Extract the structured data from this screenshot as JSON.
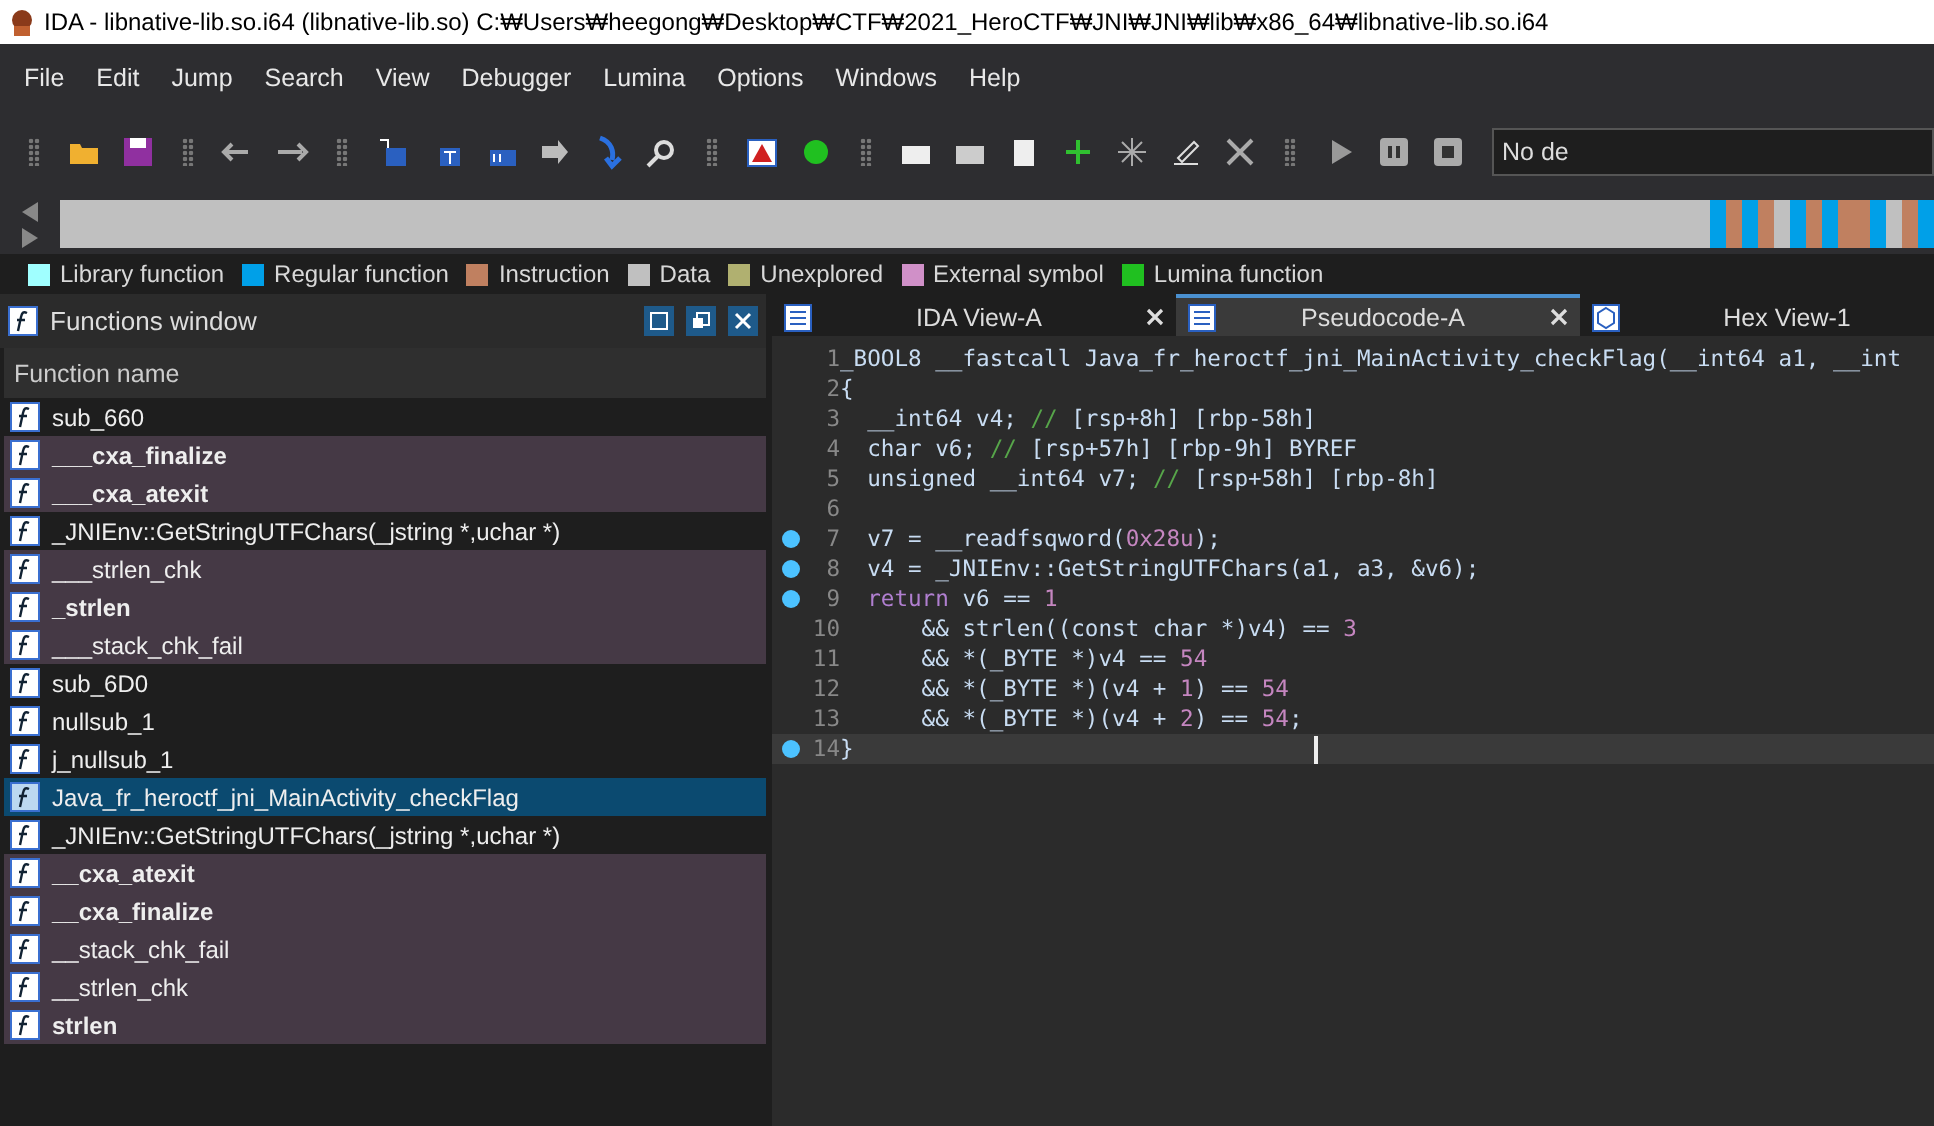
{
  "window": {
    "title": "IDA - libnative-lib.so.i64 (libnative-lib.so) C:₩Users₩heegong₩Desktop₩CTF₩2021_HeroCTF₩JNI₩JNI₩lib₩x86_64₩libnative-lib.so.i64"
  },
  "menu": [
    "File",
    "Edit",
    "Jump",
    "Search",
    "View",
    "Debugger",
    "Lumina",
    "Options",
    "Windows",
    "Help"
  ],
  "toolbar": {
    "debugger_select": "No de"
  },
  "legend": [
    {
      "label": "Library function",
      "color": "#a0ffff"
    },
    {
      "label": "Regular function",
      "color": "#00a0e8"
    },
    {
      "label": "Instruction",
      "color": "#c08060"
    },
    {
      "label": "Data",
      "color": "#c0c0c0"
    },
    {
      "label": "Unexplored",
      "color": "#b0b070"
    },
    {
      "label": "External symbol",
      "color": "#d090c8"
    },
    {
      "label": "Lumina function",
      "color": "#20c020"
    }
  ],
  "functions_window": {
    "title": "Functions window",
    "column": "Function name",
    "rows": [
      {
        "name": "sub_660",
        "kind": "regular",
        "bold": false,
        "selected": false
      },
      {
        "name": "___cxa_finalize",
        "kind": "library",
        "bold": true,
        "selected": false
      },
      {
        "name": "___cxa_atexit",
        "kind": "library",
        "bold": true,
        "selected": false
      },
      {
        "name": "_JNIEnv::GetStringUTFChars(_jstring *,uchar *)",
        "kind": "regular",
        "bold": false,
        "selected": false
      },
      {
        "name": "___strlen_chk",
        "kind": "library",
        "bold": false,
        "selected": false
      },
      {
        "name": "_strlen",
        "kind": "library",
        "bold": true,
        "selected": false
      },
      {
        "name": "___stack_chk_fail",
        "kind": "library",
        "bold": false,
        "selected": false
      },
      {
        "name": "sub_6D0",
        "kind": "regular",
        "bold": false,
        "selected": false
      },
      {
        "name": "nullsub_1",
        "kind": "regular",
        "bold": false,
        "selected": false
      },
      {
        "name": "j_nullsub_1",
        "kind": "regular",
        "bold": false,
        "selected": false
      },
      {
        "name": "Java_fr_heroctf_jni_MainActivity_checkFlag",
        "kind": "regular",
        "bold": false,
        "selected": true
      },
      {
        "name": "_JNIEnv::GetStringUTFChars(_jstring *,uchar *)",
        "kind": "regular",
        "bold": false,
        "selected": false
      },
      {
        "name": "__cxa_atexit",
        "kind": "library",
        "bold": true,
        "selected": false
      },
      {
        "name": "__cxa_finalize",
        "kind": "library",
        "bold": true,
        "selected": false
      },
      {
        "name": "__stack_chk_fail",
        "kind": "library",
        "bold": false,
        "selected": false
      },
      {
        "name": "__strlen_chk",
        "kind": "library",
        "bold": false,
        "selected": false
      },
      {
        "name": "strlen",
        "kind": "library",
        "bold": true,
        "selected": false
      }
    ]
  },
  "tabs": [
    {
      "label": "IDA View-A",
      "kind": "disasm",
      "selected": false
    },
    {
      "label": "Pseudocode-A",
      "kind": "disasm",
      "selected": true
    },
    {
      "label": "Hex View-1",
      "kind": "hex",
      "selected": false
    }
  ],
  "code": [
    {
      "number": "1",
      "marked": false,
      "current": false,
      "segments": [
        {
          "kind": "text",
          "text": "_BOOL8 __fastcall Java_fr_heroctf_jni_MainActivity_checkFlag(__int64 a1, __int"
        }
      ]
    },
    {
      "number": "2",
      "marked": false,
      "current": false,
      "segments": [
        {
          "kind": "text",
          "text": "{"
        }
      ]
    },
    {
      "number": "3",
      "marked": false,
      "current": false,
      "segments": [
        {
          "kind": "text",
          "text": "  __int64 v4; "
        },
        {
          "kind": "comment",
          "text": "//"
        },
        {
          "kind": "text",
          "text": " [rsp+8h] [rbp-58h]"
        }
      ]
    },
    {
      "number": "4",
      "marked": false,
      "current": false,
      "segments": [
        {
          "kind": "text",
          "text": "  char v6; "
        },
        {
          "kind": "comment",
          "text": "//"
        },
        {
          "kind": "text",
          "text": " [rsp+57h] [rbp-9h] BYREF"
        }
      ]
    },
    {
      "number": "5",
      "marked": false,
      "current": false,
      "segments": [
        {
          "kind": "text",
          "text": "  unsigned __int64 v7; "
        },
        {
          "kind": "comment",
          "text": "//"
        },
        {
          "kind": "text",
          "text": " [rsp+58h] [rbp-8h]"
        }
      ]
    },
    {
      "number": "6",
      "marked": false,
      "current": false
    },
    {
      "number": "7",
      "marked": true,
      "current": false,
      "segments": [
        {
          "kind": "text",
          "text": "  v7 = __readfsqword("
        },
        {
          "kind": "number",
          "text": "0x28u"
        },
        {
          "kind": "text",
          "text": ");"
        }
      ]
    },
    {
      "number": "8",
      "marked": true,
      "current": false,
      "segments": [
        {
          "kind": "text",
          "text": "  v4 = _JNIEnv::GetStringUTFChars(a1, a3, &v6);"
        }
      ]
    },
    {
      "number": "9",
      "marked": true,
      "current": false,
      "segments": [
        {
          "kind": "keyword",
          "text": "  return"
        },
        {
          "kind": "text",
          "text": " v6 == "
        },
        {
          "kind": "number",
          "text": "1"
        }
      ]
    },
    {
      "number": "10",
      "marked": false,
      "current": false,
      "segments": [
        {
          "kind": "text",
          "text": "      && strlen((const char *)v4) == "
        },
        {
          "kind": "number",
          "text": "3"
        }
      ]
    },
    {
      "number": "11",
      "marked": false,
      "current": false,
      "segments": [
        {
          "kind": "text",
          "text": "      && *(_BYTE *)v4 == "
        },
        {
          "kind": "number",
          "text": "54"
        }
      ]
    },
    {
      "number": "12",
      "marked": false,
      "current": false,
      "segments": [
        {
          "kind": "text",
          "text": "      && *(_BYTE *)(v4 + "
        },
        {
          "kind": "number",
          "text": "1"
        },
        {
          "kind": "text",
          "text": ") == "
        },
        {
          "kind": "number",
          "text": "54"
        }
      ]
    },
    {
      "number": "13",
      "marked": false,
      "current": false,
      "segments": [
        {
          "kind": "text",
          "text": "      && *(_BYTE *)(v4 + "
        },
        {
          "kind": "number",
          "text": "2"
        },
        {
          "kind": "text",
          "text": ") == "
        },
        {
          "kind": "number",
          "text": "54"
        },
        {
          "kind": "text",
          "text": ";"
        }
      ]
    },
    {
      "number": "14",
      "marked": true,
      "current": true,
      "segments": [
        {
          "kind": "text",
          "text": "}"
        }
      ]
    }
  ]
}
